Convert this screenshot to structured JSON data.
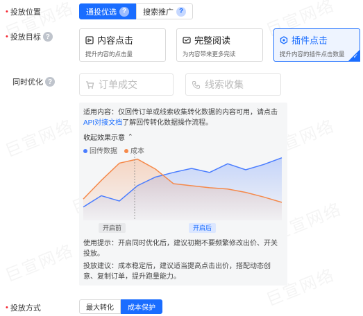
{
  "placement": {
    "label": "投放位置",
    "options": [
      {
        "label": "通投优选",
        "active": true
      },
      {
        "label": "搜索推广",
        "active": false
      }
    ]
  },
  "goal": {
    "label": "投放目标",
    "cards": [
      {
        "title": "内容点击",
        "desc": "提升内容的点击量",
        "icon": "content-icon",
        "active": false
      },
      {
        "title": "完整阅读",
        "desc": "为内容带来更多完读",
        "icon": "read-icon",
        "active": false
      },
      {
        "title": "插件点击",
        "desc": "提升内容的插件点击数量",
        "icon": "plugin-icon",
        "active": true
      }
    ]
  },
  "sync": {
    "label": "同时优化",
    "order_placeholder": "订单成交",
    "lead_placeholder": "线索收集"
  },
  "panel": {
    "scope_prefix": "适用内容：",
    "scope_text": "仅回传订单或线索收集转化数据的内容可用，请点击",
    "scope_link": "API对接文档",
    "scope_suffix": "了解回传转化数据操作流程。",
    "collapse_label": "收起效果示意",
    "tip_label": "使用提示：",
    "tip_text": "开启同时优化后，建议初期不要频繁修改出价、开关投放。",
    "advice_label": "投放建议：",
    "advice_text": "成本稳定后，建议适当提高点击出价，搭配动态创意、复制订单，提升跑量能力。"
  },
  "chart_data": {
    "type": "line",
    "series": [
      {
        "name": "回传数据",
        "color": "#4a7dff",
        "values": [
          18,
          35,
          27,
          50,
          63,
          70,
          76,
          70,
          83,
          74,
          82,
          92
        ]
      },
      {
        "name": "成本",
        "color": "#f5894a",
        "values": [
          30,
          58,
          84,
          90,
          75,
          53,
          50,
          47,
          45,
          40,
          33,
          25
        ]
      }
    ],
    "split_label_before": "开启前",
    "split_label_after": "开启后",
    "grid": false
  },
  "mode": {
    "label": "投放方式",
    "options": [
      {
        "label": "最大转化",
        "active": false
      },
      {
        "label": "成本保护",
        "active": true
      }
    ]
  },
  "watermark": "巨宣网络",
  "colors": {
    "accent": "#1a6dff",
    "required": "#f5222d",
    "cost": "#f5894a",
    "data": "#4a7dff"
  }
}
